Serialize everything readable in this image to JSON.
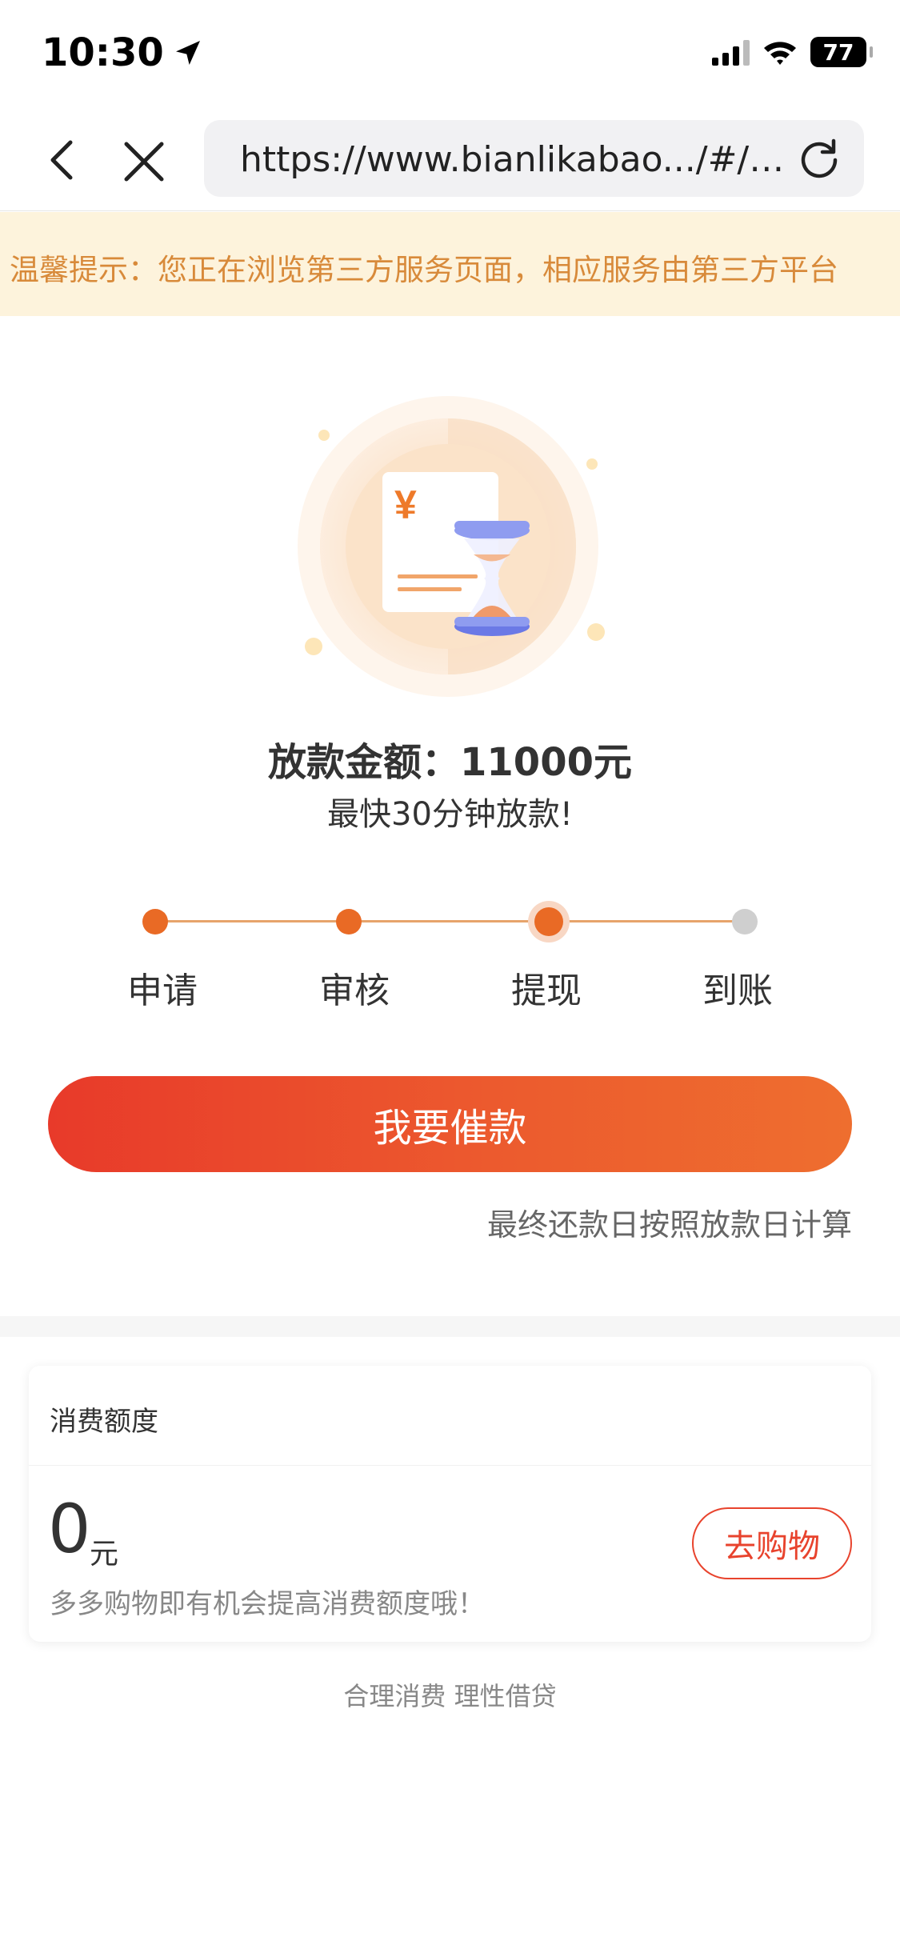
{
  "status_bar": {
    "time": "10:30",
    "battery": "77"
  },
  "browser": {
    "url": "https://www.bianlikabao.../#/l..."
  },
  "notice": {
    "text": "温馨提示：您正在浏览第三方服务页面，相应服务由第三方平台"
  },
  "loan": {
    "amount_title": "放款金额：11000元",
    "subtitle": "最快30分钟放款!",
    "currency_symbol": "¥"
  },
  "steps": [
    {
      "label": "申请",
      "state": "done"
    },
    {
      "label": "审核",
      "state": "done"
    },
    {
      "label": "提现",
      "state": "current"
    },
    {
      "label": "到账",
      "state": "pending"
    }
  ],
  "actions": {
    "urge_button": "我要催款",
    "repay_note": "最终还款日按照放款日计算"
  },
  "credit_card": {
    "title": "消费额度",
    "amount": "0",
    "unit": "元",
    "hint": "多多购物即有机会提高消费额度哦！",
    "shop_button": "去购物"
  },
  "footer": {
    "text": "合理消费 理性借贷"
  },
  "colors": {
    "accent": "#e96a25",
    "primary_start": "#e83a2a",
    "primary_end": "#ee6e2f",
    "notice_bg": "#fdf3dc",
    "notice_text": "#d88a3a"
  }
}
